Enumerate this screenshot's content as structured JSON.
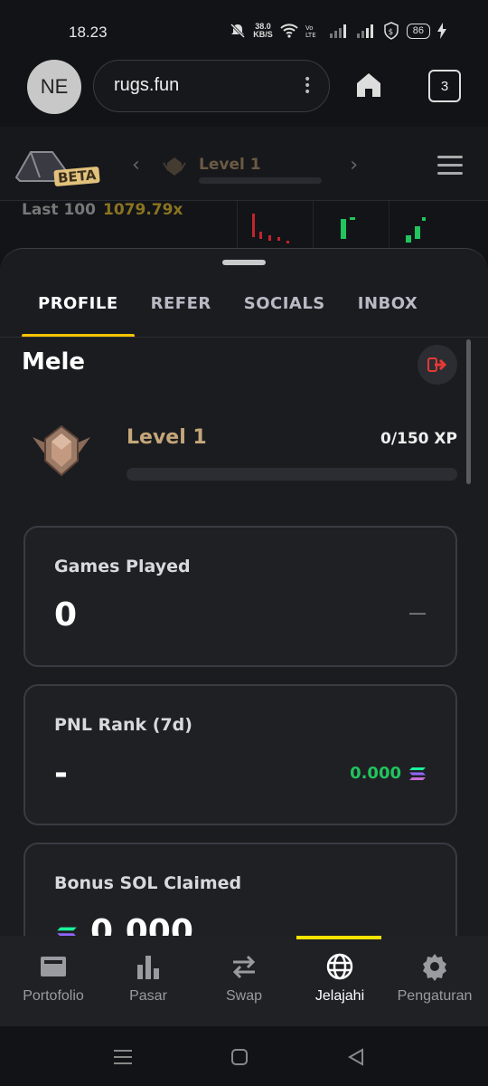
{
  "status_bar": {
    "time": "18.23",
    "net_speed": "38.0",
    "net_unit": "KB/S",
    "battery": "86"
  },
  "browser": {
    "avatar_initials": "NE",
    "url": "rugs.fun",
    "tabs_count": "3"
  },
  "site_header": {
    "beta_label": "BETA",
    "level_label": "Level 1"
  },
  "history": {
    "label": "Last 100",
    "value": "1079.79x"
  },
  "sheet": {
    "tabs": [
      {
        "label": "PROFILE",
        "active": true
      },
      {
        "label": "REFER",
        "active": false
      },
      {
        "label": "SOCIALS",
        "active": false
      },
      {
        "label": "INBOX",
        "active": false
      }
    ],
    "username": "Mele",
    "level": "Level 1",
    "xp": "0/150 XP",
    "xp_progress": 0,
    "cards": [
      {
        "title": "Games Played",
        "value": "0",
        "aside": "—"
      },
      {
        "title": "PNL Rank (7d)",
        "value": "-",
        "sol_value": "0.000"
      },
      {
        "title": "Bonus SOL Claimed",
        "value": "0.000"
      }
    ]
  },
  "bottom_nav": {
    "items": [
      {
        "label": "Portofolio",
        "icon": "wallet-icon"
      },
      {
        "label": "Pasar",
        "icon": "bar-chart-icon"
      },
      {
        "label": "Swap",
        "icon": "swap-arrows-icon"
      },
      {
        "label": "Jelajahi",
        "icon": "globe-icon",
        "active": true
      },
      {
        "label": "Pengaturan",
        "icon": "gear-icon"
      }
    ]
  },
  "colors": {
    "accent": "#f5c400",
    "positive": "#21c45d",
    "level": "#c4a77a",
    "background": "#1b1c20"
  }
}
